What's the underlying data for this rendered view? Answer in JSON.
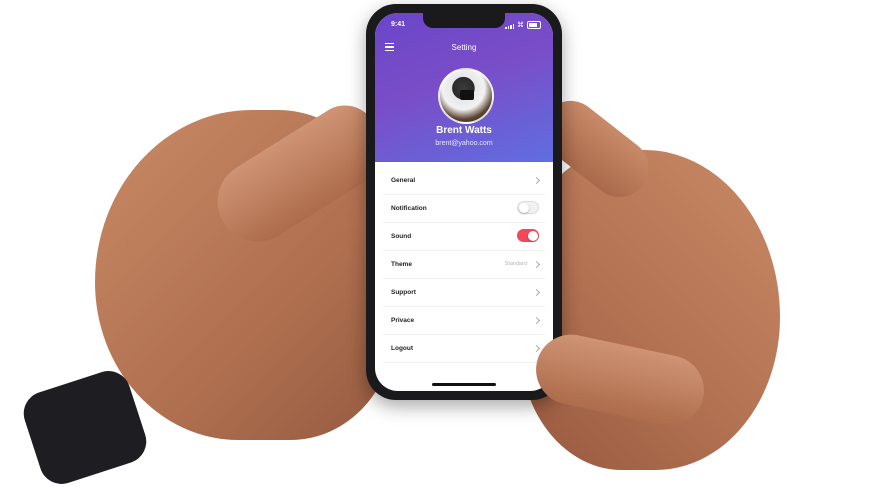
{
  "status_bar": {
    "time": "9:41"
  },
  "header": {
    "title": "Setting",
    "user_name": "Brent Watts",
    "user_email": "brent@yahoo.com"
  },
  "settings": {
    "items": [
      {
        "label": "General",
        "type": "link"
      },
      {
        "label": "Notification",
        "type": "toggle",
        "enabled": false
      },
      {
        "label": "Sound",
        "type": "toggle",
        "enabled": true
      },
      {
        "label": "Theme",
        "type": "link",
        "value": "Standard"
      },
      {
        "label": "Support",
        "type": "link"
      },
      {
        "label": "Privace",
        "type": "link"
      },
      {
        "label": "Logout",
        "type": "link"
      }
    ]
  },
  "colors": {
    "header_gradient_start": "#6a46c9",
    "header_gradient_end": "#5f6ee0",
    "toggle_on": "#ef4a5a"
  },
  "icons": [
    "menu-icon",
    "chevron-right-icon",
    "signal-icon",
    "wifi-icon",
    "battery-icon"
  ]
}
